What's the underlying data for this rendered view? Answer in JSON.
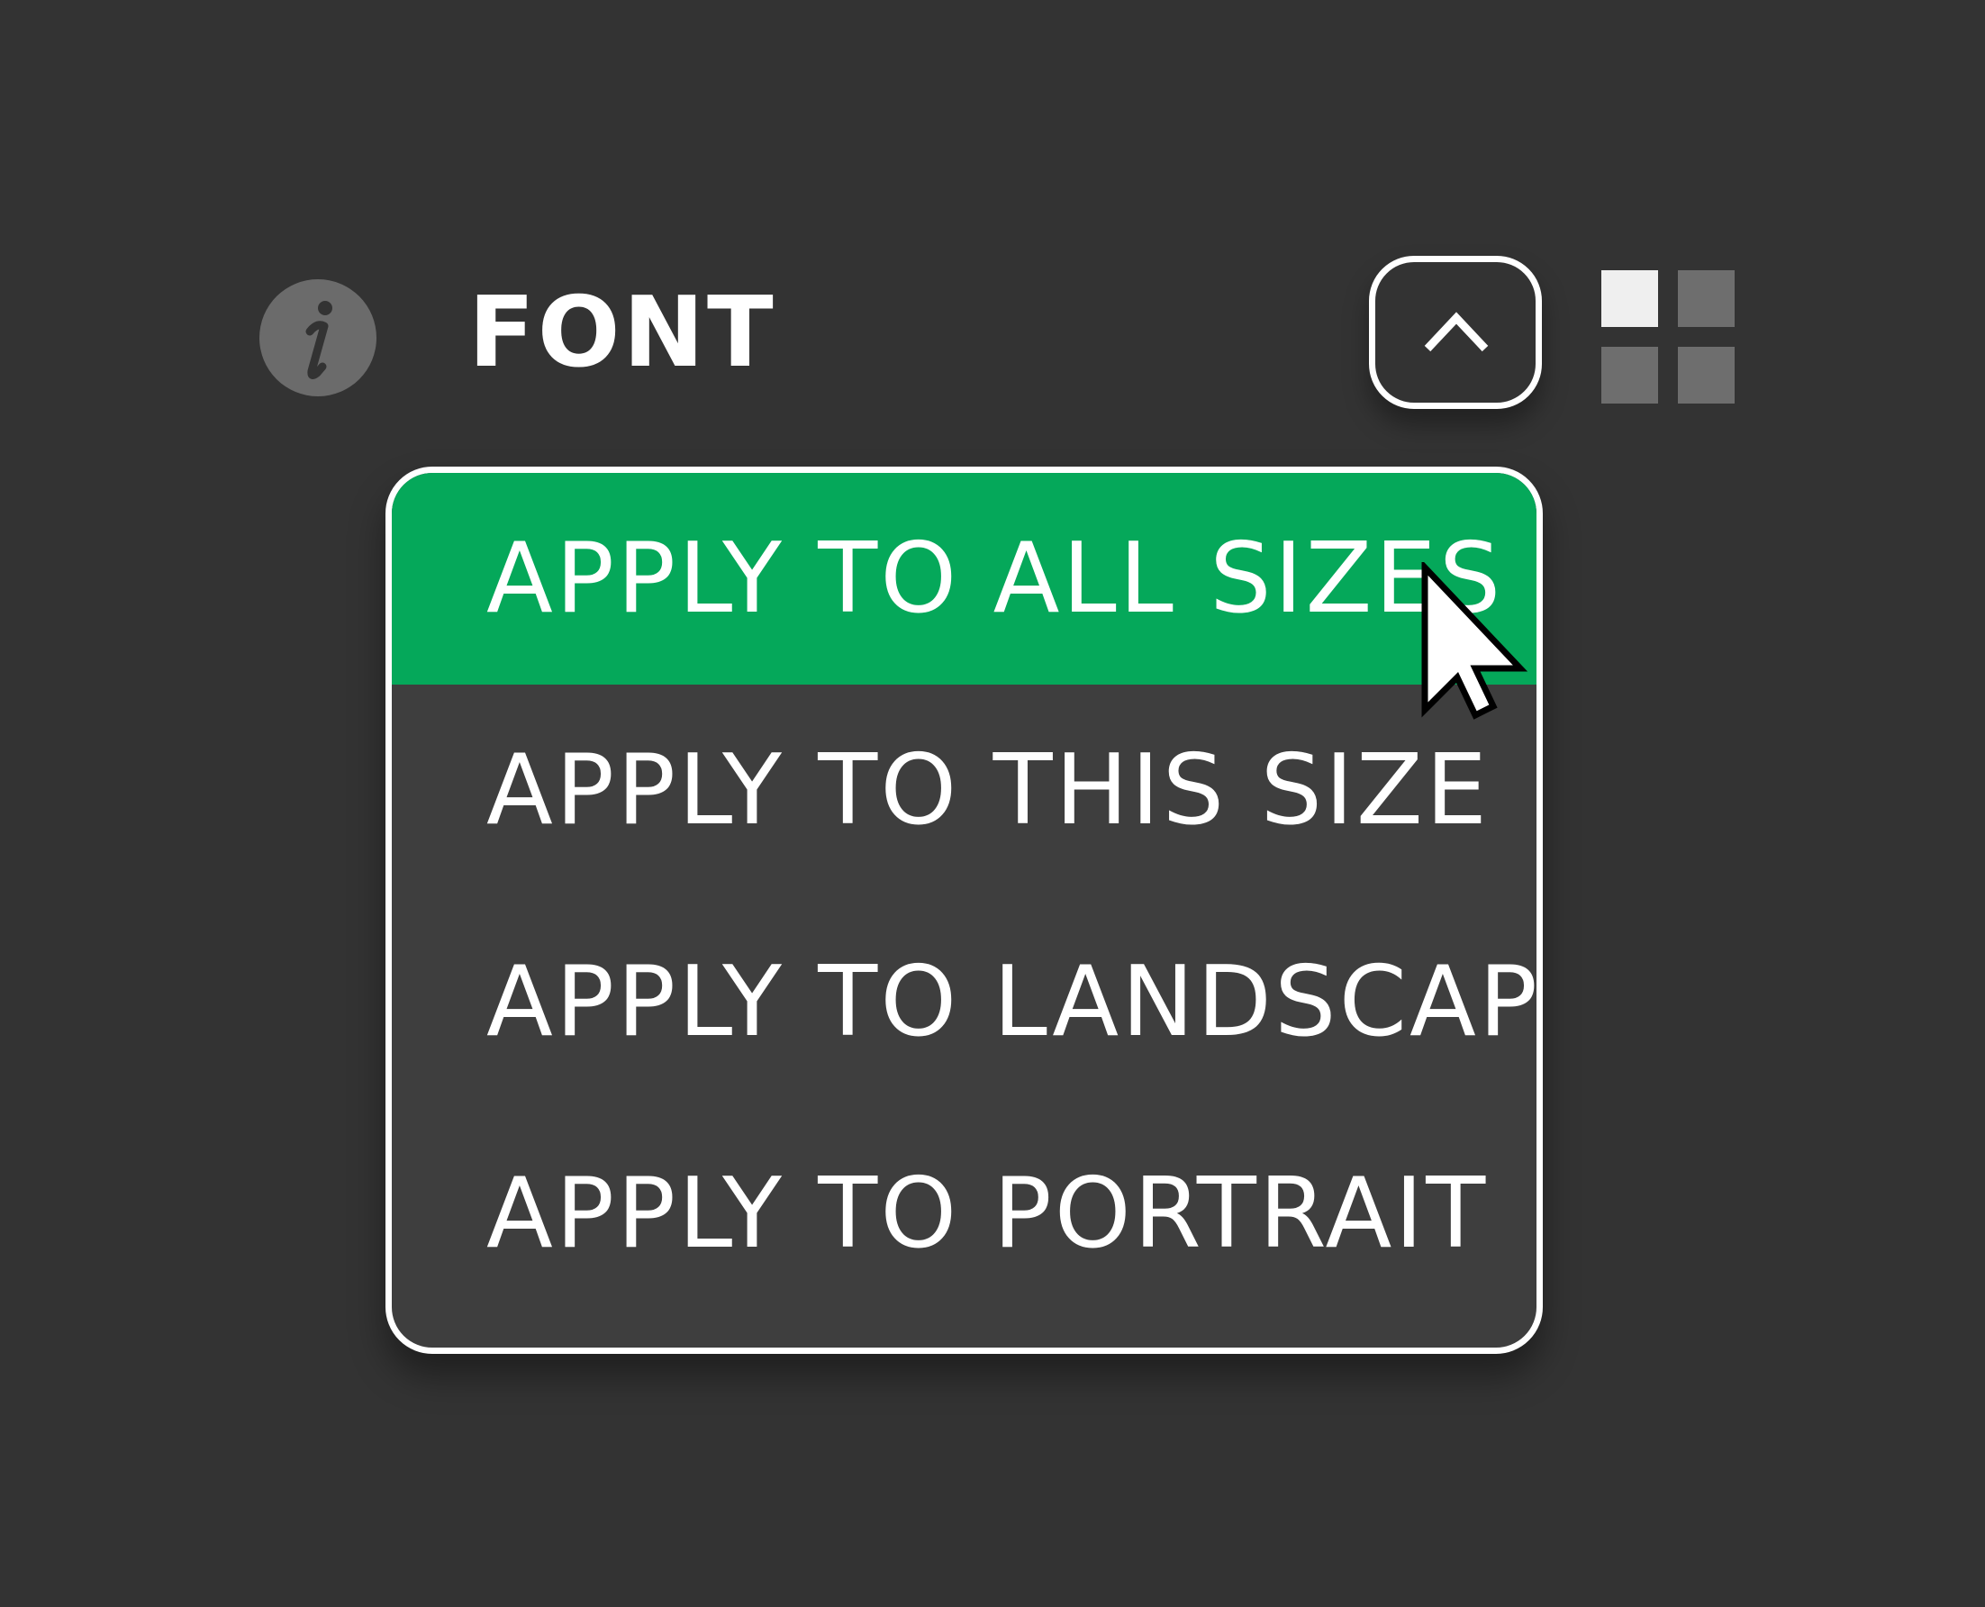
{
  "panel": {
    "title": "FONT",
    "info_icon": "info-icon",
    "collapse_icon": "chevron-up-icon",
    "layout_icon": "grid-view-icon"
  },
  "menu": {
    "items": [
      {
        "label": "APPLY TO ALL SIZES",
        "selected": true
      },
      {
        "label": "APPLY TO THIS SIZE",
        "selected": false
      },
      {
        "label": "APPLY TO LANDSCAPE",
        "selected": false
      },
      {
        "label": "APPLY TO PORTRAIT",
        "selected": false
      }
    ]
  },
  "colors": {
    "background": "#333333",
    "menu_background": "#3e3e3e",
    "selected": "#05a85a",
    "text": "#ffffff",
    "icon_gray": "#6b6b6b",
    "grid_active": "#efefef"
  }
}
